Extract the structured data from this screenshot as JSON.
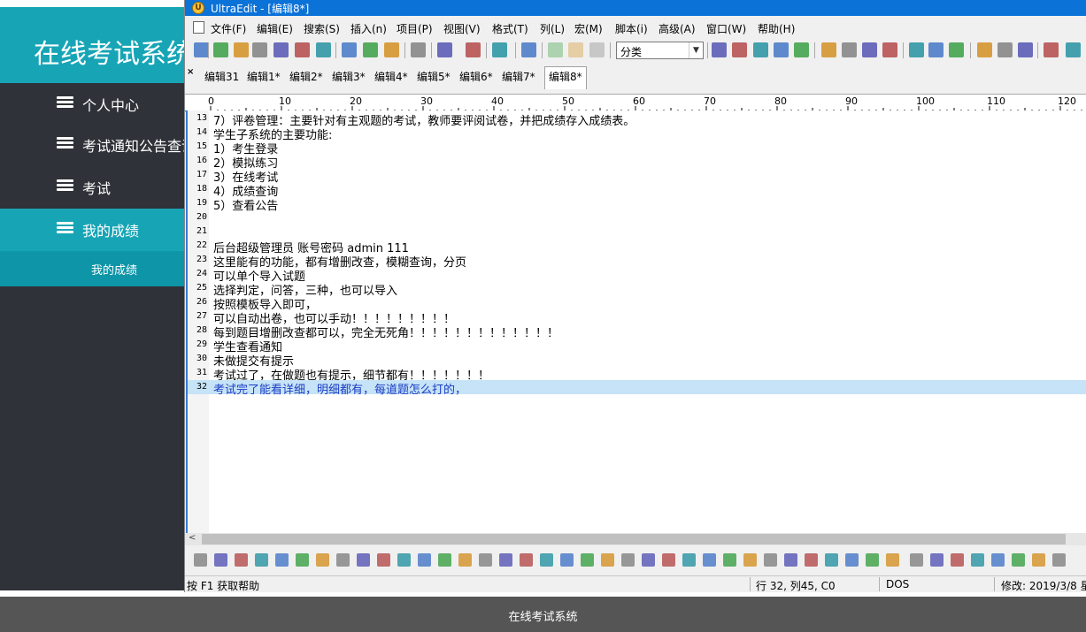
{
  "app": {
    "brand_title": "在线考试系统",
    "footer_text": "在线考试系统",
    "nav": [
      {
        "label": "个人中心",
        "active": false
      },
      {
        "label": "考试通知公告查询",
        "active": false
      },
      {
        "label": "考试",
        "active": false
      },
      {
        "label": "我的成绩",
        "active": true
      }
    ],
    "subnav": {
      "label": "我的成绩"
    },
    "colors": {
      "accent": "#17a5b6",
      "sidebar": "#2f3238",
      "footer": "#555555"
    }
  },
  "editor_window": {
    "title": "UltraEdit - [编辑8*]",
    "menu": [
      "文件(F)",
      "编辑(E)",
      "搜索(S)",
      "插入(n)",
      "项目(P)",
      "视图(V)",
      "格式(T)",
      "列(L)",
      "宏(M)",
      "脚本(i)",
      "高级(A)",
      "窗口(W)",
      "帮助(H)"
    ],
    "combo_value": "分类",
    "tabs": [
      {
        "label": "编辑31",
        "active": false
      },
      {
        "label": "编辑1*",
        "active": false
      },
      {
        "label": "编辑2*",
        "active": false
      },
      {
        "label": "编辑3*",
        "active": false
      },
      {
        "label": "编辑4*",
        "active": false
      },
      {
        "label": "编辑5*",
        "active": false
      },
      {
        "label": "编辑6*",
        "active": false
      },
      {
        "label": "编辑7*",
        "active": false
      },
      {
        "label": "编辑8*",
        "active": true
      }
    ],
    "ruler_labels": [
      "0",
      "10",
      "20",
      "30",
      "40",
      "50",
      "60",
      "70",
      "80",
      "90",
      "100",
      "110",
      "120"
    ],
    "lines": [
      {
        "n": "13",
        "text": "7）评卷管理：主要针对有主观题的考试，教师要评阅试卷，并把成绩存入成绩表。",
        "current": false
      },
      {
        "n": "14",
        "text": "学生子系统的主要功能:",
        "current": false
      },
      {
        "n": "15",
        "text": "1）考生登录",
        "current": false
      },
      {
        "n": "16",
        "text": "2）模拟练习",
        "current": false
      },
      {
        "n": "17",
        "text": "3）在线考试",
        "current": false
      },
      {
        "n": "18",
        "text": "4）成绩查询",
        "current": false
      },
      {
        "n": "19",
        "text": "5）查看公告",
        "current": false
      },
      {
        "n": "20",
        "text": "",
        "current": false
      },
      {
        "n": "21",
        "text": "",
        "current": false
      },
      {
        "n": "22",
        "text": "后台超级管理员 账号密码 admin 111",
        "current": false
      },
      {
        "n": "23",
        "text": "这里能有的功能，都有增删改查，模糊查询，分页",
        "current": false
      },
      {
        "n": "24",
        "text": "可以单个导入试题",
        "current": false
      },
      {
        "n": "25",
        "text": "选择判定，问答，三种，也可以导入",
        "current": false
      },
      {
        "n": "26",
        "text": "按照模板导入即可，",
        "current": false
      },
      {
        "n": "27",
        "text": "可以自动出卷，也可以手动！！！！！！！！！",
        "current": false
      },
      {
        "n": "28",
        "text": "每到题目增删改查都可以，完全无死角！！！！！！！！！！！！！",
        "current": false
      },
      {
        "n": "29",
        "text": "学生查看通知",
        "current": false
      },
      {
        "n": "30",
        "text": "未做提交有提示",
        "current": false
      },
      {
        "n": "31",
        "text": "考试过了，在做题也有提示，细节都有！！！！！！！",
        "current": false
      },
      {
        "n": "32",
        "text": "考试完了能看详细，明细都有，每道题怎么打的，",
        "current": true
      }
    ],
    "status": {
      "help": "按 F1 获取帮助",
      "position": "行 32, 列45, C0",
      "format": "DOS",
      "modified": "修改: 2019/3/8 星"
    },
    "toolbar1_icons": [
      "new-file-icon",
      "arrow-left-icon",
      "arrow-right-icon",
      "blank-file-icon",
      "open-folder-icon",
      "open-folder-2-icon",
      "save-icon",
      "print-icon",
      "print-preview-icon",
      "image-icon",
      "notes-icon",
      "word-wrap-icon",
      "hex-icon",
      "clipboard-icon",
      "globe-icon",
      "cut-icon",
      "copy-icon",
      "paste-icon",
      "find-icon",
      "find-next-icon",
      "find-prev-icon",
      "replace-icon",
      "print-2-icon",
      "align-left-icon",
      "align-center-icon",
      "align-right-icon",
      "justify-icon",
      "split-h-icon",
      "split-v-icon",
      "cascade-icon",
      "browser-icon",
      "web-preview-icon",
      "readonly-icon",
      "info-icon",
      "help-icon"
    ],
    "toolbar2_icons": [
      "bookmark-icon",
      "bold-icon",
      "italic-icon",
      "underline-icon",
      "indent-icon",
      "bullets-icon",
      "numbering-icon",
      "font-color-icon",
      "highlight-icon",
      "align-left-2-icon",
      "align-center-2-icon",
      "align-right-2-icon",
      "align-justify-2-icon",
      "table-icon",
      "hr-icon",
      "form-icon",
      "input-icon",
      "textarea-icon",
      "button-icon",
      "checkbox-icon",
      "radio-icon",
      "frame-icon",
      "picture-icon",
      "anchor-icon",
      "select-icon",
      "symbol-icon",
      "html-help-icon",
      "grid-icon",
      "copy-2-icon",
      "check-icon",
      "id-icon",
      "number-icon",
      "tools-icon",
      "doc-icon",
      "question-icon",
      "google-icon",
      "yahoo-icon",
      "wikipedia-icon",
      "dictionary-icon",
      "bulb-icon",
      "sun-icon",
      "n-icon",
      "php-icon"
    ]
  }
}
